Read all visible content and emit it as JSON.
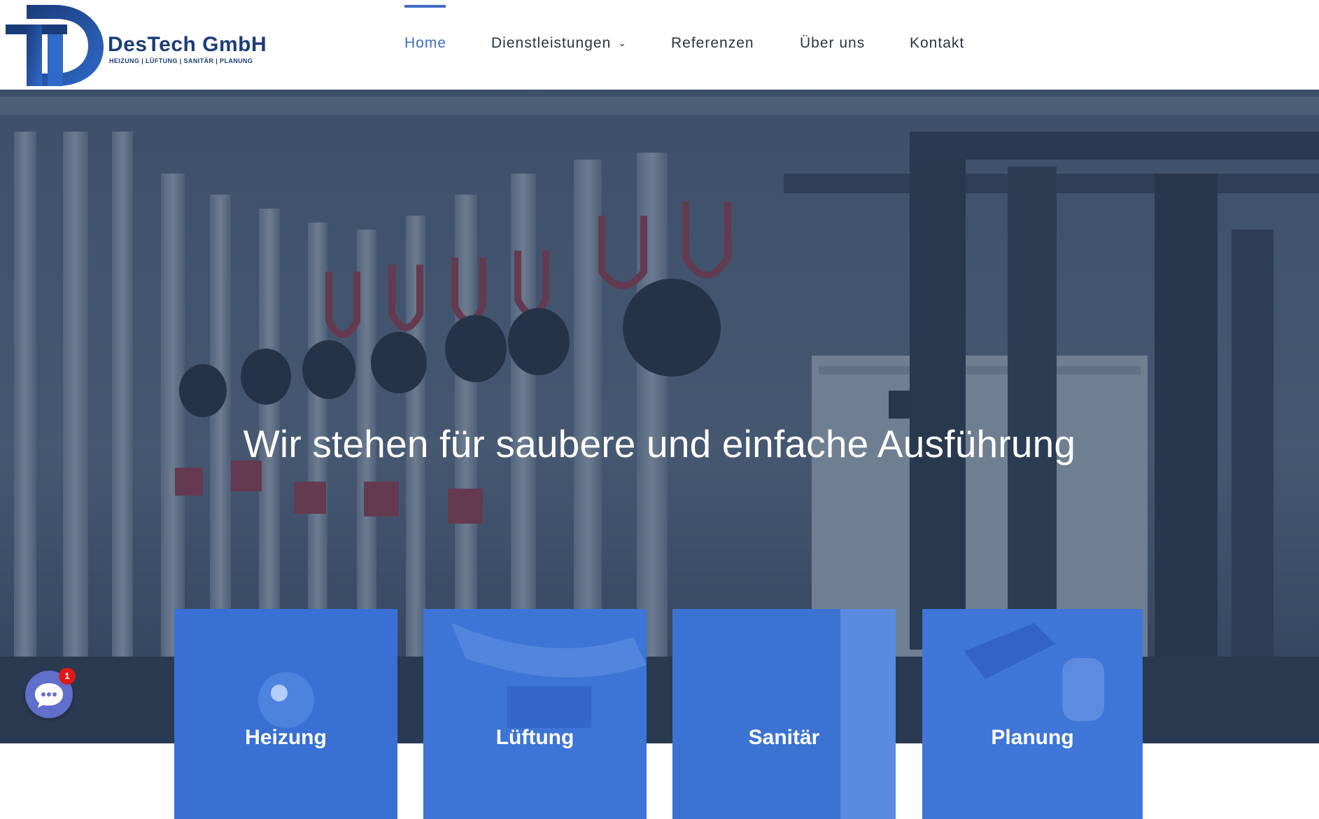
{
  "brand": {
    "name": "DesTech GmbH",
    "tagline": "HEIZUNG | LÜFTUNG | SANITÄR | PLANUNG",
    "logo_letter": "D",
    "color_primary": "#1d3c78",
    "color_accent": "#2f6ac9"
  },
  "nav": {
    "items": [
      {
        "label": "Home",
        "active": true
      },
      {
        "label": "Dienstleistungen",
        "has_dropdown": true
      },
      {
        "label": "Referenzen"
      },
      {
        "label": "Über uns"
      },
      {
        "label": "Kontakt"
      }
    ],
    "dropdown_icon": "chevron-down-icon"
  },
  "hero": {
    "headline": "Wir stehen für saubere und einfache Ausführung"
  },
  "services": [
    {
      "title": "Heizung"
    },
    {
      "title": "Lüftung"
    },
    {
      "title": "Sanitär"
    },
    {
      "title": "Planung"
    }
  ],
  "chat_widget": {
    "icon": "chat-bubble-icon",
    "badge_count": "1"
  }
}
